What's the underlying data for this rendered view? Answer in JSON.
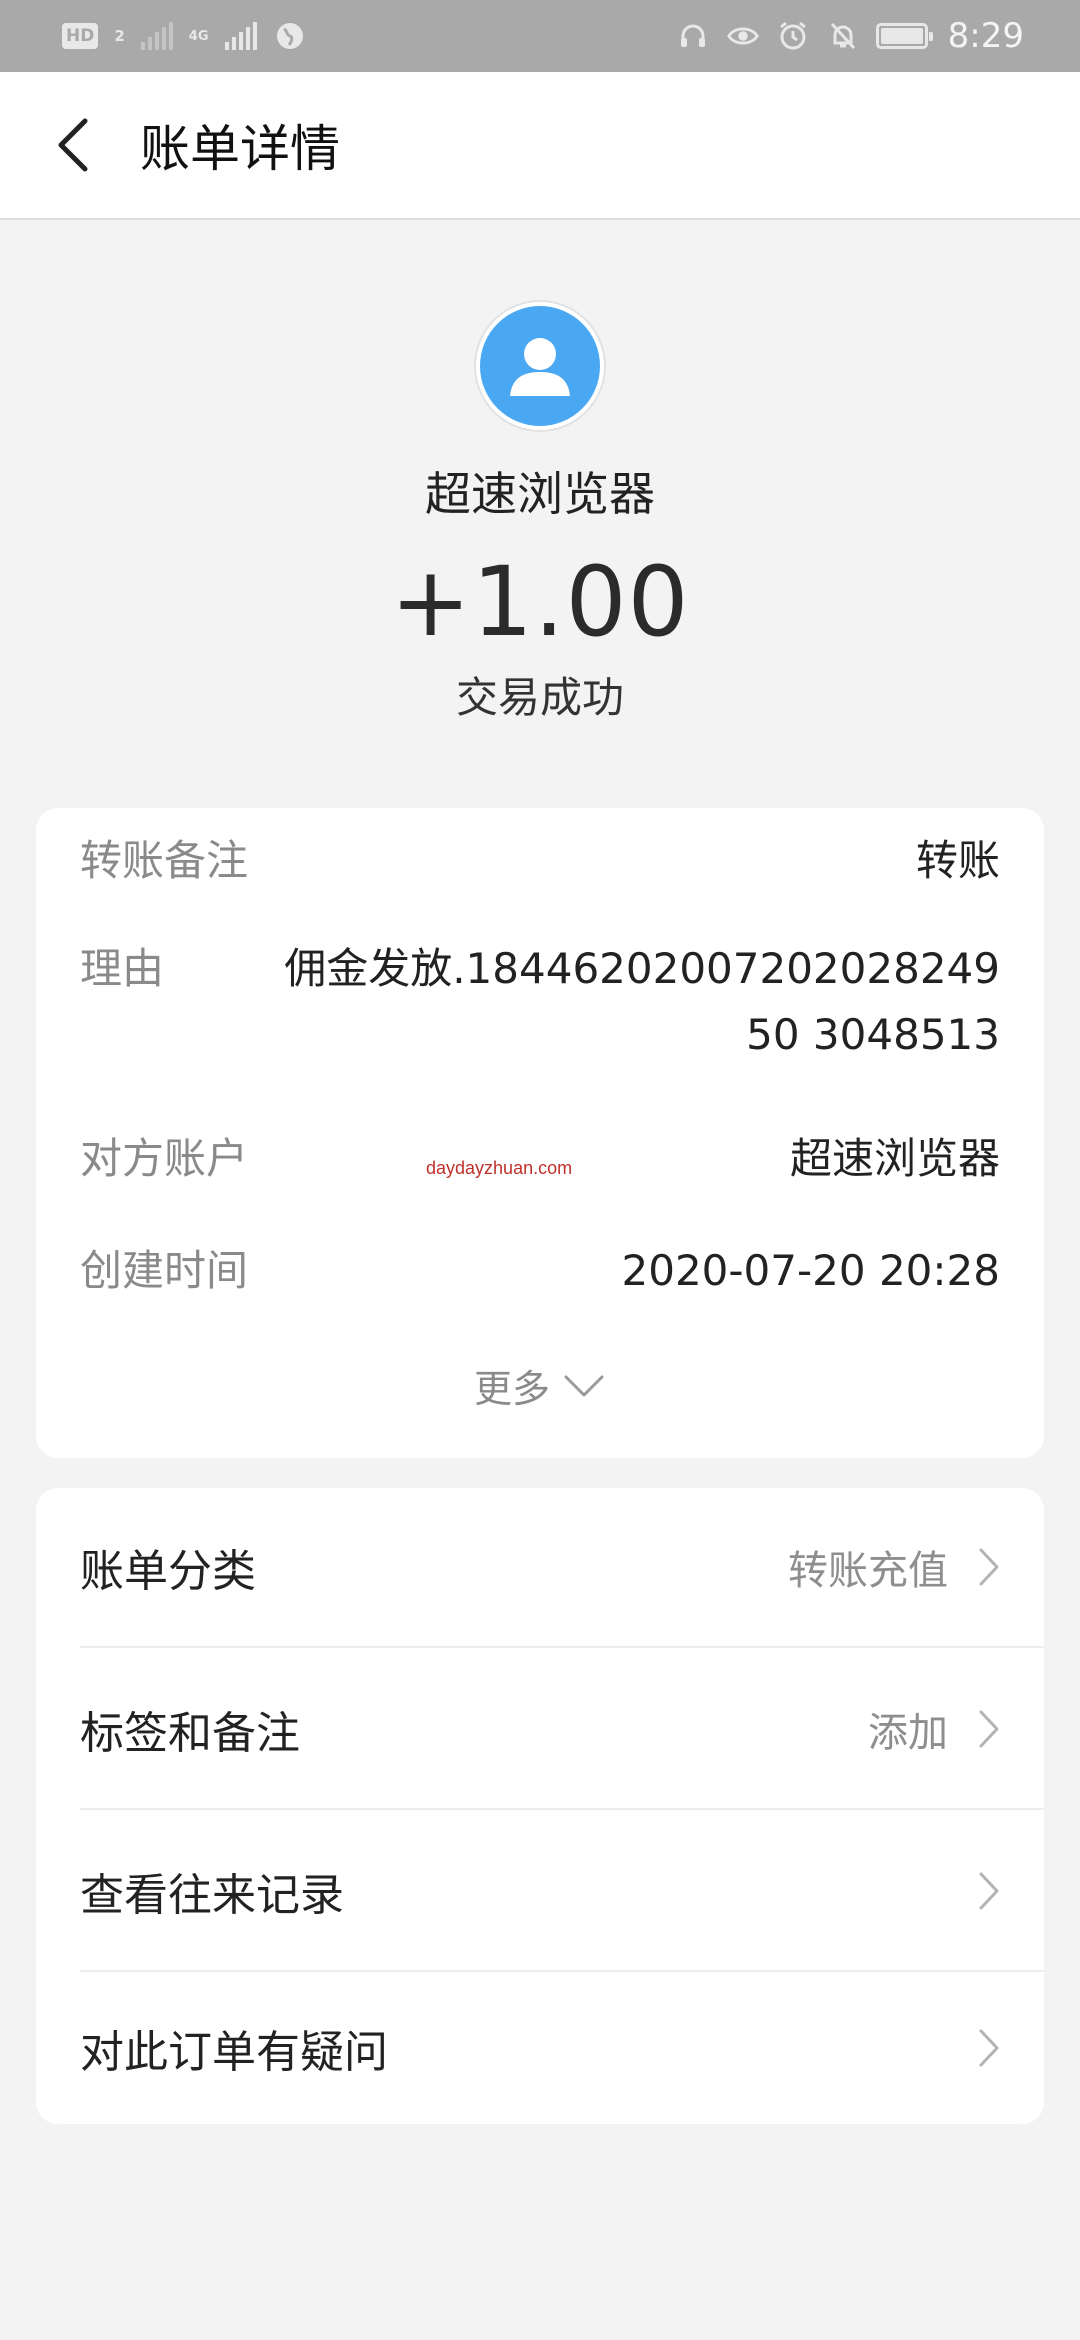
{
  "status_bar": {
    "hd_label": "HD",
    "sim_label": "2",
    "network_label": "4G",
    "time": "8:29"
  },
  "nav": {
    "title": "账单详情"
  },
  "header": {
    "counterparty": "超速浏览器",
    "amount": "+1.00",
    "status": "交易成功"
  },
  "details": {
    "rows": [
      {
        "label": "转账备注",
        "value": "转账"
      },
      {
        "label": "理由",
        "value": "佣金发放.1844620200720202824950 3048513"
      },
      {
        "label": "对方账户",
        "value": "超速浏览器"
      },
      {
        "label": "创建时间",
        "value": "2020-07-20 20:28"
      }
    ],
    "watermark": "daydayzhuan.com",
    "more_label": "更多"
  },
  "menu": {
    "items": [
      {
        "label": "账单分类",
        "value": "转账充值"
      },
      {
        "label": "标签和备注",
        "value": "添加"
      },
      {
        "label": "查看往来记录",
        "value": ""
      },
      {
        "label": "对此订单有疑问",
        "value": ""
      }
    ]
  },
  "colors": {
    "status_bar": "#a9a9a9",
    "avatar": "#4aa8f3",
    "watermark": "#c0302b"
  }
}
